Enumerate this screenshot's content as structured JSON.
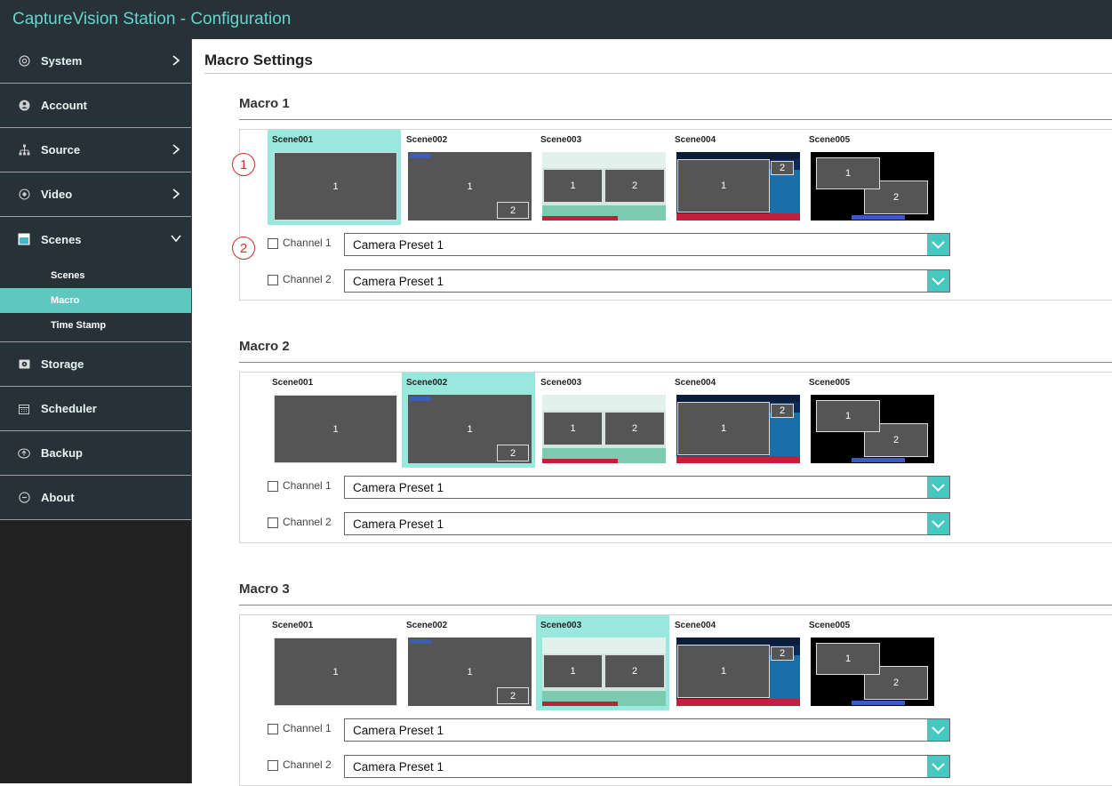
{
  "app": {
    "title": "CaptureVision Station - Configuration"
  },
  "colors": {
    "accent": "#5ec7c0",
    "selected_scene": "#98e8de",
    "titlebar": "#263238",
    "callout": "#d0302a"
  },
  "sidebar": {
    "items": [
      {
        "label": "System",
        "icon": "gear-icon"
      },
      {
        "label": "Account",
        "icon": "user-icon"
      },
      {
        "label": "Source",
        "icon": "network-icon"
      },
      {
        "label": "Video",
        "icon": "radio-dot-icon"
      },
      {
        "label": "Scenes",
        "icon": "scenes-icon"
      },
      {
        "label": "Storage",
        "icon": "storage-icon"
      },
      {
        "label": "Scheduler",
        "icon": "calendar-icon"
      },
      {
        "label": "Backup",
        "icon": "upload-icon"
      },
      {
        "label": "About",
        "icon": "info-icon"
      }
    ],
    "scenes_sub": [
      {
        "label": "Scenes"
      },
      {
        "label": "Macro"
      },
      {
        "label": "Time Stamp"
      }
    ]
  },
  "main": {
    "title": "Macro Settings"
  },
  "scene_names": [
    "Scene001",
    "Scene002",
    "Scene003",
    "Scene004",
    "Scene005"
  ],
  "pane_numbers": {
    "one": "1",
    "two": "2"
  },
  "macros": [
    {
      "title": "Macro 1",
      "selected_scene": "Scene001",
      "channels": [
        {
          "label": "Channel 1",
          "checked": false,
          "preset": "Camera Preset 1"
        },
        {
          "label": "Channel 2",
          "checked": false,
          "preset": "Camera Preset 1"
        }
      ]
    },
    {
      "title": "Macro 2",
      "selected_scene": "Scene002",
      "channels": [
        {
          "label": "Channel 1",
          "checked": false,
          "preset": "Camera Preset 1"
        },
        {
          "label": "Channel 2",
          "checked": false,
          "preset": "Camera Preset 1"
        }
      ]
    },
    {
      "title": "Macro 3",
      "selected_scene": "Scene003",
      "channels": [
        {
          "label": "Channel 1",
          "checked": false,
          "preset": "Camera Preset 1"
        },
        {
          "label": "Channel 2",
          "checked": false,
          "preset": "Camera Preset 1"
        }
      ]
    }
  ],
  "callouts": [
    "1",
    "2"
  ]
}
